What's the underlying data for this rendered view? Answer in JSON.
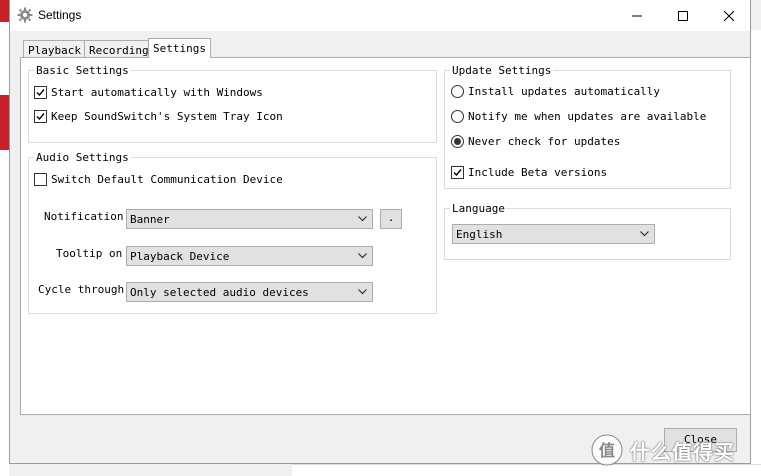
{
  "window": {
    "title": "Settings"
  },
  "tabs": [
    {
      "label": "Playback",
      "active": false
    },
    {
      "label": "Recording",
      "active": false
    },
    {
      "label": "Settings",
      "active": true
    }
  ],
  "basic_settings": {
    "title": "Basic Settings",
    "start_with_windows": {
      "label": "Start automatically with Windows",
      "checked": true
    },
    "keep_tray_icon": {
      "label": "Keep SoundSwitch's System Tray Icon",
      "checked": true
    }
  },
  "audio_settings": {
    "title": "Audio Settings",
    "switch_comm_device": {
      "label": "Switch Default Communication Device",
      "checked": false
    },
    "notification": {
      "label": "Notification",
      "value": "Banner",
      "extra_button": "."
    },
    "tooltip_on": {
      "label": "Tooltip on",
      "value": "Playback Device"
    },
    "cycle_through": {
      "label": "Cycle through",
      "value": "Only selected audio devices"
    }
  },
  "update_settings": {
    "title": "Update Settings",
    "install_auto": {
      "label": "Install updates automatically",
      "selected": false
    },
    "notify_me": {
      "label": "Notify me when updates are available",
      "selected": false
    },
    "never_check": {
      "label": "Never check for updates",
      "selected": true
    },
    "include_beta": {
      "label": "Include Beta versions",
      "checked": true
    }
  },
  "language": {
    "title": "Language",
    "value": "English"
  },
  "footer": {
    "close_label": "Close"
  },
  "watermark": {
    "text": "什么值得买"
  }
}
